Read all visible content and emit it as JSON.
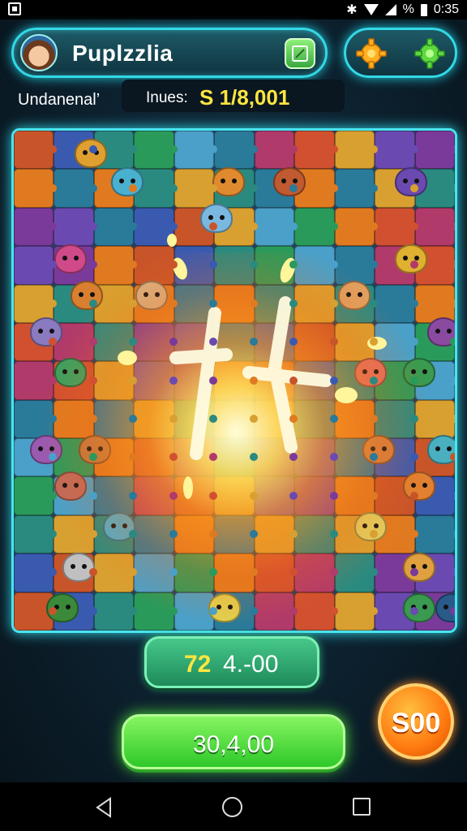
{
  "status_bar": {
    "time": "0:35",
    "icons": [
      "notification-icon",
      "bluetooth-icon",
      "wifi-icon",
      "signal-icon",
      "battery-icon"
    ],
    "battery_label": "%"
  },
  "header": {
    "title": "Puplzzlia",
    "avatar_icon": "character-avatar",
    "edit_icon": "edit-icon",
    "settings_icons": [
      "gear-orange-icon",
      "gear-green-icon"
    ]
  },
  "info": {
    "label": "Undanenal’",
    "sub_label": "Inues:",
    "value": "S 1/8,001"
  },
  "score": {
    "primary": "72",
    "secondary": "4.-00"
  },
  "main_button": {
    "label": "30,4,00"
  },
  "coin": {
    "label": "S00"
  },
  "colors": {
    "accent_cyan": "#33d8e6",
    "score_yellow": "#ffe640",
    "button_green": "#52e040",
    "coin_orange": "#ff7a10"
  }
}
